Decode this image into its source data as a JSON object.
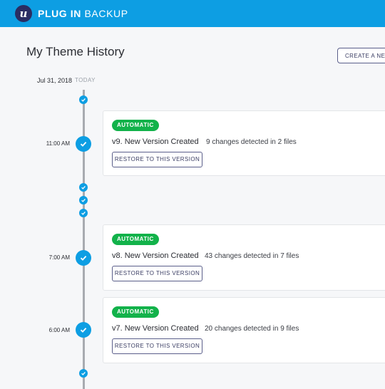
{
  "app": {
    "logo_letter": "u",
    "brand_bold": "PLUG IN",
    "brand_light": "BACKUP"
  },
  "page": {
    "title": "My Theme History",
    "create_label": "CREATE A NEW"
  },
  "timeline": {
    "date": "Jul 31, 2018",
    "today": "TODAY"
  },
  "colors": {
    "accent": "#0d9ee3",
    "badge": "#12b24a",
    "navy": "#2a2d63"
  },
  "versions": [
    {
      "time": "11:00 AM",
      "badge": "AUTOMATIC",
      "title": "v9. New Version Created",
      "changes": "9 changes detected in 2 files",
      "restore": "RESTORE TO THIS VERSION"
    },
    {
      "time": "7:00 AM",
      "badge": "AUTOMATIC",
      "title": "v8. New Version Created",
      "changes": "43 changes detected in 7 files",
      "restore": "RESTORE TO THIS VERSION"
    },
    {
      "time": "6:00 AM",
      "badge": "AUTOMATIC",
      "title": "v7. New Version Created",
      "changes": "20 changes detected in 9 files",
      "restore": "RESTORE TO THIS VERSION"
    }
  ]
}
